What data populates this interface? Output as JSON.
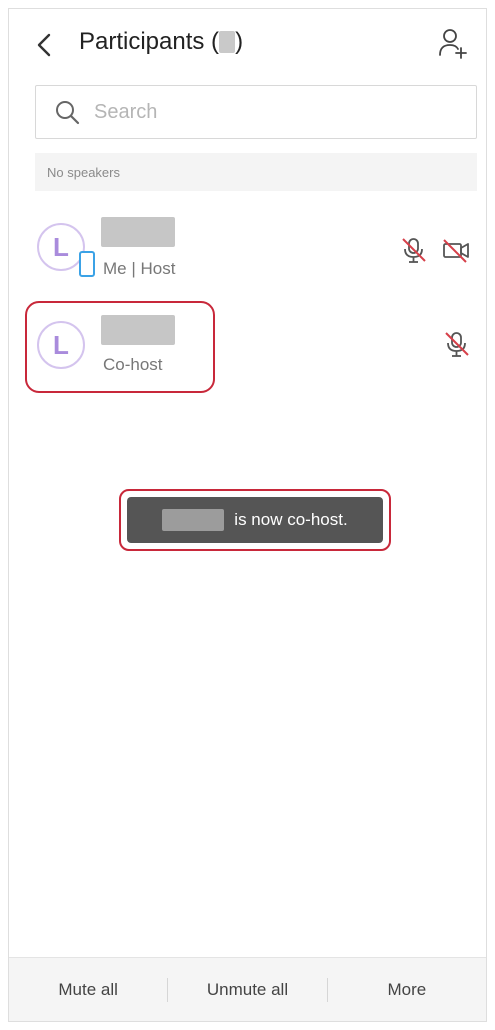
{
  "header": {
    "back_icon": "chevron-left-icon",
    "title": "Participants (",
    "title_close": ")",
    "add_icon": "add-participant-icon"
  },
  "search": {
    "placeholder": "Search",
    "value": "",
    "icon": "search-icon"
  },
  "speakers_label": "No speakers",
  "participants": [
    {
      "avatar_letter": "L",
      "role": "Me | Host",
      "device_icon": "phone-icon",
      "mic_icon": "mic-off-icon",
      "camera_icon": "camera-off-icon"
    },
    {
      "avatar_letter": "L",
      "role": "Co-host",
      "mic_icon": "mic-off-icon"
    }
  ],
  "toast": {
    "text": "is now co-host."
  },
  "bottom_bar": {
    "mute_all": "Mute all",
    "unmute_all": "Unmute all",
    "more": "More"
  },
  "colors": {
    "avatar_accent": "#a98bdc",
    "phone_badge": "#3ba2e6",
    "highlight": "#c8283a",
    "toast_bg": "#555555"
  }
}
